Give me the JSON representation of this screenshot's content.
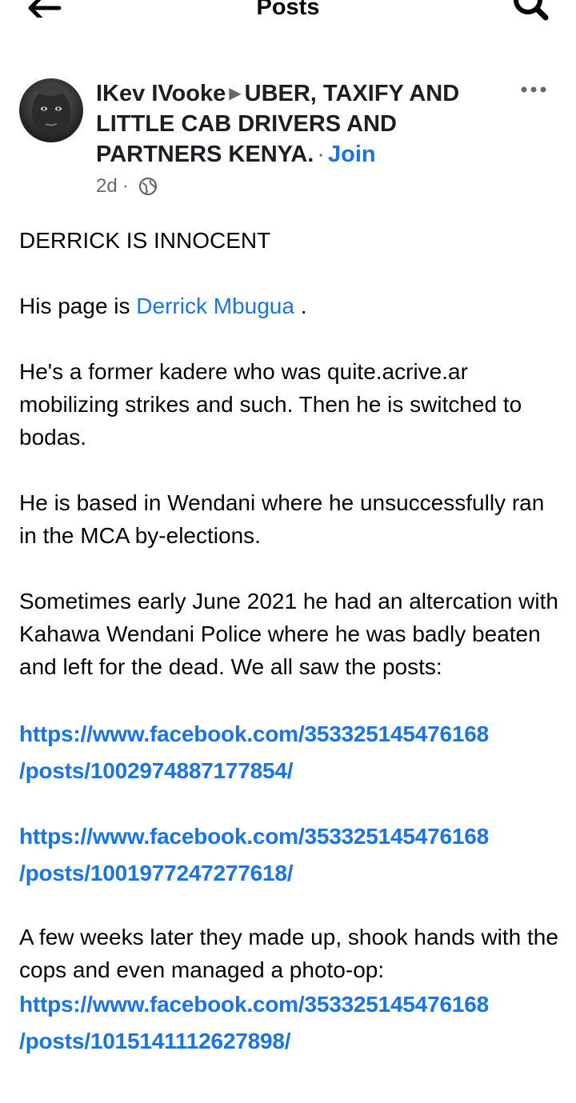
{
  "topbar": {
    "title": "Posts",
    "back_icon": "back-arrow-icon",
    "search_icon": "search-icon"
  },
  "post": {
    "author": "IKev IVooke",
    "arrow": "▶",
    "group": "UBER, TAXIFY AND LITTLE CAB DRIVERS AND PARTNERS KENYA.",
    "separator": "·",
    "join_label": "Join",
    "time": "2d",
    "meta_separator": "·",
    "privacy_icon": "globe-icon",
    "more_icon": "more-options-icon",
    "body": {
      "headline": "DERRICK IS INNOCENT",
      "page_prefix": "His page is ",
      "page_mention": "Derrick Mbugua",
      "page_suffix": " .",
      "para1": "He's a former kadere who was quite.acrive.ar mobilizing strikes and such. Then he is switched to bodas.",
      "para2": "He is based in Wendani where he unsuccessfully ran in the MCA by-elections.",
      "para3": "Sometimes early June 2021 he had an altercation with Kahawa Wendani Police where he was badly beaten and left for the dead. We all saw the posts:",
      "link1_line1": "https://www.facebook.com/353325145476168",
      "link1_line2": "/posts/1002974887177854/",
      "link2_line1": "https://www.facebook.com/353325145476168",
      "link2_line2": "/posts/1001977247277618/",
      "para4": "A few weeks later they made up, shook hands with the cops and even managed a photo-op:",
      "link3_line1": "https://www.facebook.com/353325145476168",
      "link3_line2": "/posts/1015141112627898/"
    }
  },
  "colors": {
    "link": "#1b74e4",
    "text": "#050505",
    "secondary": "#65676b"
  }
}
